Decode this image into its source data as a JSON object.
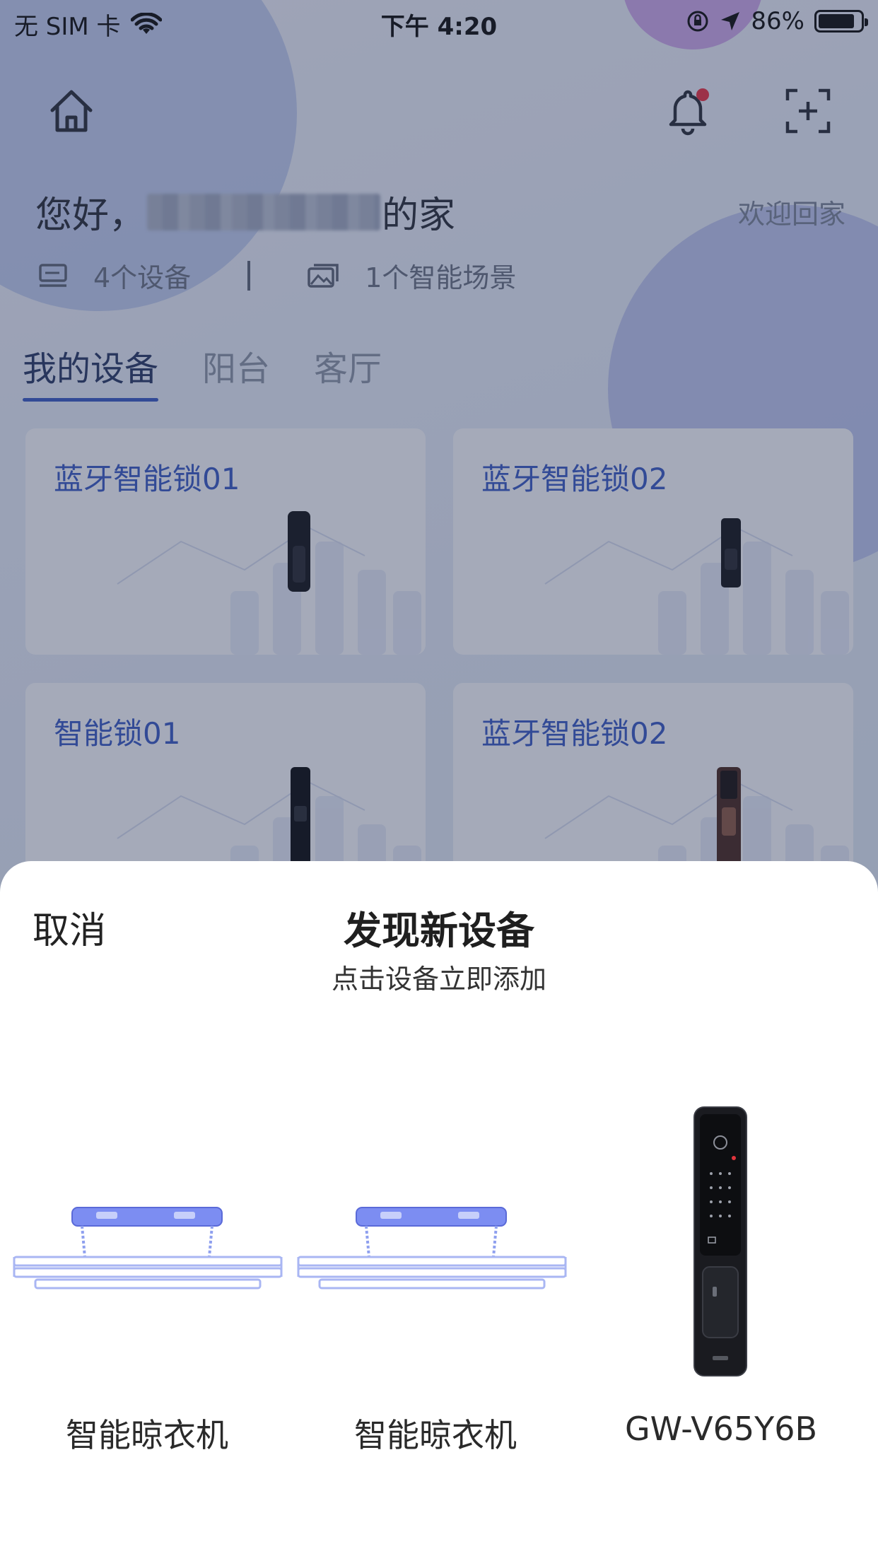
{
  "status_bar": {
    "carrier": "无 SIM 卡",
    "time": "下午 4:20",
    "battery": "86%",
    "battery_level": 0.86
  },
  "header": {
    "greeting_prefix": "您好，",
    "greeting_suffix": "的家",
    "welcome": "欢迎回家",
    "device_count": "4个设备",
    "scene_count": "1个智能场景",
    "notification_unread": true
  },
  "tabs": [
    {
      "label": "我的设备",
      "active": true
    },
    {
      "label": "阳台",
      "active": false
    },
    {
      "label": "客厅",
      "active": false
    }
  ],
  "devices": [
    {
      "name": "蓝牙智能锁01"
    },
    {
      "name": "蓝牙智能锁02"
    },
    {
      "name": "智能锁01"
    },
    {
      "name": "蓝牙智能锁02"
    }
  ],
  "sheet": {
    "cancel": "取消",
    "title": "发现新设备",
    "subtitle": "点击设备立即添加",
    "found": [
      {
        "label": "智能晾衣机",
        "icon": "clothes-rack"
      },
      {
        "label": "智能晾衣机",
        "icon": "clothes-rack"
      },
      {
        "label": "GW-V65Y6B",
        "icon": "smart-lock"
      }
    ]
  }
}
